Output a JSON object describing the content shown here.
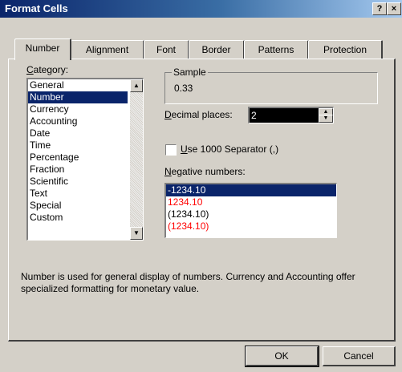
{
  "window": {
    "title": "Format Cells",
    "help_glyph": "?",
    "close_glyph": "×"
  },
  "tabs": [
    {
      "label": "Number",
      "active": true
    },
    {
      "label": "Alignment"
    },
    {
      "label": "Font"
    },
    {
      "label": "Border"
    },
    {
      "label": "Patterns"
    },
    {
      "label": "Protection"
    }
  ],
  "category": {
    "label": "Category:",
    "items": [
      "General",
      "Number",
      "Currency",
      "Accounting",
      "Date",
      "Time",
      "Percentage",
      "Fraction",
      "Scientific",
      "Text",
      "Special",
      "Custom"
    ],
    "selected": "Number"
  },
  "sample": {
    "label": "Sample",
    "value": "0.33"
  },
  "decimal_places": {
    "label": "Decimal places:",
    "value": "2"
  },
  "separator": {
    "label": "Use 1000 Separator (,)",
    "checked": false
  },
  "negative_numbers": {
    "label": "Negative numbers:",
    "items": [
      {
        "text": "-1234.10",
        "color": "#000000",
        "selected": true
      },
      {
        "text": "1234.10",
        "color": "#ff0000"
      },
      {
        "text": "(1234.10)",
        "color": "#000000"
      },
      {
        "text": "(1234.10)",
        "color": "#ff0000"
      }
    ]
  },
  "description": "Number is used for general display of numbers.  Currency and Accounting offer specialized formatting for monetary value.",
  "buttons": {
    "ok": "OK",
    "cancel": "Cancel"
  },
  "colors": {
    "selection": "#0a246a",
    "negative_red": "#ff0000",
    "face": "#d4d0c8"
  }
}
